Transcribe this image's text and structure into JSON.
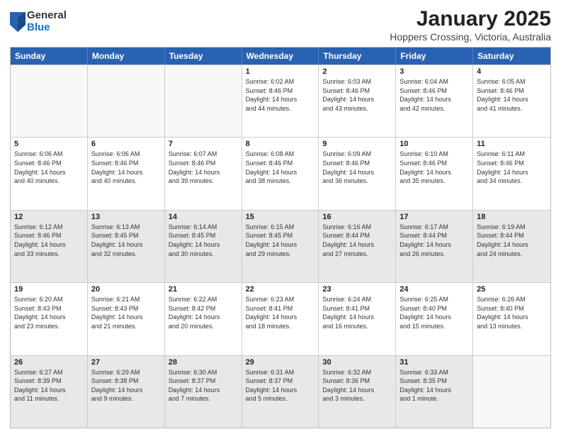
{
  "logo": {
    "general": "General",
    "blue": "Blue"
  },
  "title": "January 2025",
  "subtitle": "Hoppers Crossing, Victoria, Australia",
  "days_of_week": [
    "Sunday",
    "Monday",
    "Tuesday",
    "Wednesday",
    "Thursday",
    "Friday",
    "Saturday"
  ],
  "weeks": [
    [
      {
        "day": "",
        "info": "",
        "empty": true
      },
      {
        "day": "",
        "info": "",
        "empty": true
      },
      {
        "day": "",
        "info": "",
        "empty": true
      },
      {
        "day": "1",
        "info": "Sunrise: 6:02 AM\nSunset: 8:46 PM\nDaylight: 14 hours\nand 44 minutes."
      },
      {
        "day": "2",
        "info": "Sunrise: 6:03 AM\nSunset: 8:46 PM\nDaylight: 14 hours\nand 43 minutes."
      },
      {
        "day": "3",
        "info": "Sunrise: 6:04 AM\nSunset: 8:46 PM\nDaylight: 14 hours\nand 42 minutes."
      },
      {
        "day": "4",
        "info": "Sunrise: 6:05 AM\nSunset: 8:46 PM\nDaylight: 14 hours\nand 41 minutes."
      }
    ],
    [
      {
        "day": "5",
        "info": "Sunrise: 6:06 AM\nSunset: 8:46 PM\nDaylight: 14 hours\nand 40 minutes."
      },
      {
        "day": "6",
        "info": "Sunrise: 6:06 AM\nSunset: 8:46 PM\nDaylight: 14 hours\nand 40 minutes."
      },
      {
        "day": "7",
        "info": "Sunrise: 6:07 AM\nSunset: 8:46 PM\nDaylight: 14 hours\nand 39 minutes."
      },
      {
        "day": "8",
        "info": "Sunrise: 6:08 AM\nSunset: 8:46 PM\nDaylight: 14 hours\nand 38 minutes."
      },
      {
        "day": "9",
        "info": "Sunrise: 6:09 AM\nSunset: 8:46 PM\nDaylight: 14 hours\nand 36 minutes."
      },
      {
        "day": "10",
        "info": "Sunrise: 6:10 AM\nSunset: 8:46 PM\nDaylight: 14 hours\nand 35 minutes."
      },
      {
        "day": "11",
        "info": "Sunrise: 6:11 AM\nSunset: 8:46 PM\nDaylight: 14 hours\nand 34 minutes."
      }
    ],
    [
      {
        "day": "12",
        "info": "Sunrise: 6:12 AM\nSunset: 8:46 PM\nDaylight: 14 hours\nand 33 minutes.",
        "shaded": true
      },
      {
        "day": "13",
        "info": "Sunrise: 6:13 AM\nSunset: 8:45 PM\nDaylight: 14 hours\nand 32 minutes.",
        "shaded": true
      },
      {
        "day": "14",
        "info": "Sunrise: 6:14 AM\nSunset: 8:45 PM\nDaylight: 14 hours\nand 30 minutes.",
        "shaded": true
      },
      {
        "day": "15",
        "info": "Sunrise: 6:15 AM\nSunset: 8:45 PM\nDaylight: 14 hours\nand 29 minutes.",
        "shaded": true
      },
      {
        "day": "16",
        "info": "Sunrise: 6:16 AM\nSunset: 8:44 PM\nDaylight: 14 hours\nand 27 minutes.",
        "shaded": true
      },
      {
        "day": "17",
        "info": "Sunrise: 6:17 AM\nSunset: 8:44 PM\nDaylight: 14 hours\nand 26 minutes.",
        "shaded": true
      },
      {
        "day": "18",
        "info": "Sunrise: 6:19 AM\nSunset: 8:44 PM\nDaylight: 14 hours\nand 24 minutes.",
        "shaded": true
      }
    ],
    [
      {
        "day": "19",
        "info": "Sunrise: 6:20 AM\nSunset: 8:43 PM\nDaylight: 14 hours\nand 23 minutes."
      },
      {
        "day": "20",
        "info": "Sunrise: 6:21 AM\nSunset: 8:43 PM\nDaylight: 14 hours\nand 21 minutes."
      },
      {
        "day": "21",
        "info": "Sunrise: 6:22 AM\nSunset: 8:42 PM\nDaylight: 14 hours\nand 20 minutes."
      },
      {
        "day": "22",
        "info": "Sunrise: 6:23 AM\nSunset: 8:41 PM\nDaylight: 14 hours\nand 18 minutes."
      },
      {
        "day": "23",
        "info": "Sunrise: 6:24 AM\nSunset: 8:41 PM\nDaylight: 14 hours\nand 16 minutes."
      },
      {
        "day": "24",
        "info": "Sunrise: 6:25 AM\nSunset: 8:40 PM\nDaylight: 14 hours\nand 15 minutes."
      },
      {
        "day": "25",
        "info": "Sunrise: 6:26 AM\nSunset: 8:40 PM\nDaylight: 14 hours\nand 13 minutes."
      }
    ],
    [
      {
        "day": "26",
        "info": "Sunrise: 6:27 AM\nSunset: 8:39 PM\nDaylight: 14 hours\nand 11 minutes.",
        "shaded": true
      },
      {
        "day": "27",
        "info": "Sunrise: 6:29 AM\nSunset: 8:38 PM\nDaylight: 14 hours\nand 9 minutes.",
        "shaded": true
      },
      {
        "day": "28",
        "info": "Sunrise: 6:30 AM\nSunset: 8:37 PM\nDaylight: 14 hours\nand 7 minutes.",
        "shaded": true
      },
      {
        "day": "29",
        "info": "Sunrise: 6:31 AM\nSunset: 8:37 PM\nDaylight: 14 hours\nand 5 minutes.",
        "shaded": true
      },
      {
        "day": "30",
        "info": "Sunrise: 6:32 AM\nSunset: 8:36 PM\nDaylight: 14 hours\nand 3 minutes.",
        "shaded": true
      },
      {
        "day": "31",
        "info": "Sunrise: 6:33 AM\nSunset: 8:35 PM\nDaylight: 14 hours\nand 1 minute.",
        "shaded": true
      },
      {
        "day": "",
        "info": "",
        "empty": true,
        "shaded": true
      }
    ]
  ]
}
